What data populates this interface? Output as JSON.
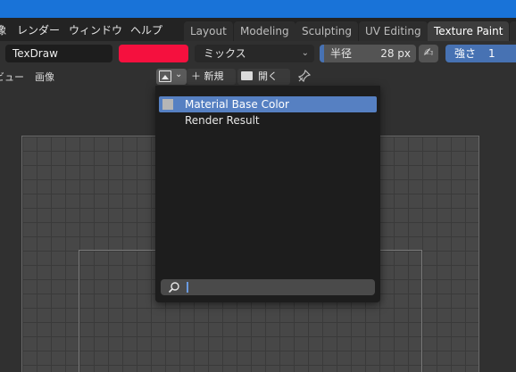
{
  "menubar": {
    "items": [
      "像",
      "レンダー",
      "ウィンドウ",
      "ヘルプ"
    ],
    "workspace_tabs": [
      "Layout",
      "Modeling",
      "Sculpting",
      "UV Editing",
      "Texture Paint"
    ],
    "active_tab": "Texture Paint"
  },
  "toolbar": {
    "brush_name": "TexDraw",
    "brush_color": "#f5103e",
    "blend_mode": "ミックス",
    "radius_label": "半径",
    "radius_value": "28 px",
    "strength_label": "強さ",
    "strength_value": "1"
  },
  "header": {
    "view_menu": "ビュー",
    "image_menu": "画像",
    "new_label": "新規",
    "open_label": "開く"
  },
  "dropdown": {
    "items": [
      {
        "label": "Material Base Color",
        "selected": true
      },
      {
        "label": "Render Result",
        "selected": false
      }
    ],
    "search_placeholder": ""
  },
  "icons": {
    "image": "image-icon",
    "new": "plus-icon",
    "open": "folder-icon",
    "pin": "pin-icon",
    "pressure": "pen-pressure-icon",
    "search": "search-icon"
  },
  "colors": {
    "titlebar": "#1973d8",
    "accent": "#4772b3",
    "selection": "#5680c2"
  }
}
